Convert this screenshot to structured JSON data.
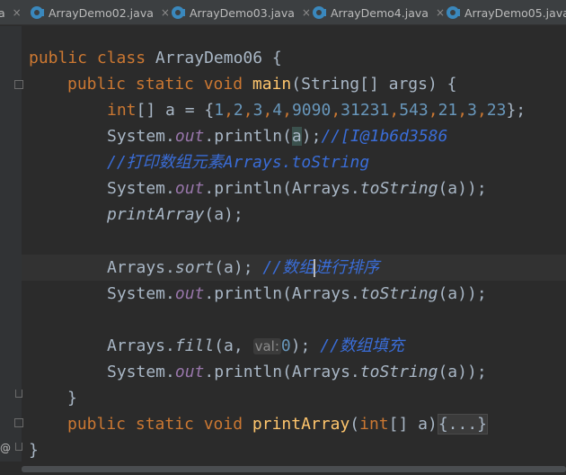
{
  "tabs": [
    {
      "label": "a",
      "close": "×"
    },
    {
      "label": "ArrayDemo02.java",
      "close": "×"
    },
    {
      "label": "ArrayDemo03.java",
      "close": "×"
    },
    {
      "label": "ArrayDemo4.java",
      "close": "×"
    },
    {
      "label": "ArrayDemo05.java",
      "close": "×"
    }
  ],
  "code": {
    "l1": {
      "kw": "public class ",
      "name": "ArrayDemo06 {"
    },
    "l2": {
      "kw": "public static void ",
      "fn": "main",
      "rest": "(String[] args) {"
    },
    "l3": {
      "kw": "int",
      "a": "[] a = {",
      "n1": "1",
      "n2": "2",
      "n3": "3",
      "n4": "4",
      "n5": "9090",
      "n6": "31231",
      "n7": "543",
      "n8": "21",
      "n9": "3",
      "n10": "23",
      "end": "};",
      "comma": ","
    },
    "l4": {
      "pre": "System.",
      "fld": "out",
      "mid": ".println(",
      "arg": "a",
      "end": ");",
      "cmt": "//[I@1b6d3586"
    },
    "l5": {
      "cmt": "//打印数组元素Arrays.toString"
    },
    "l6": {
      "pre": "System.",
      "fld": "out",
      "mid": ".println(Arrays.",
      "it": "toString",
      "end": "(a));"
    },
    "l7": {
      "it": "printArray",
      "end": "(a);"
    },
    "l9": {
      "pre": "Arrays.",
      "it": "sort",
      "end": "(a); ",
      "cmt1": "//数组",
      "cmt2": "进行排序"
    },
    "l10": {
      "pre": "System.",
      "fld": "out",
      "mid": ".println(Arrays.",
      "it": "toString",
      "end": "(a));"
    },
    "l12": {
      "pre": "Arrays.",
      "it": "fill",
      "open": "(a, ",
      "hint": "val:",
      "num": "0",
      "end": "); ",
      "cmt": "//数组填充"
    },
    "l13": {
      "pre": "System.",
      "fld": "out",
      "mid": ".println(Arrays.",
      "it": "toString",
      "end": "(a));"
    },
    "l14": {
      "close": "}"
    },
    "l15": {
      "kw": "public static void ",
      "fn": "printArray",
      "mid": "(",
      "kw2": "int",
      "rest": "[] a)",
      "fold": "{...}"
    },
    "l16": {
      "close": "}"
    }
  },
  "gutter": {
    "override_marker": "@"
  }
}
